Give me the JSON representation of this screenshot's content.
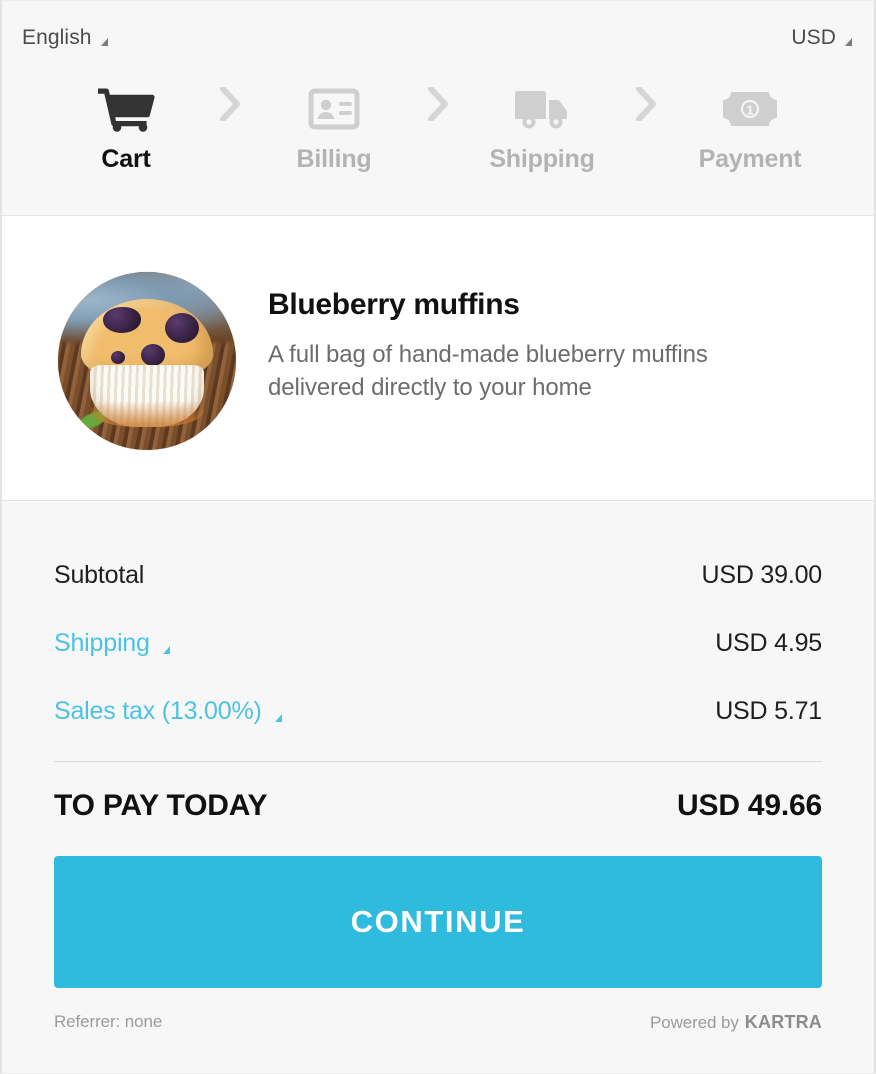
{
  "topbar": {
    "language": {
      "value": "English",
      "icon": "triangle-down-icon"
    },
    "currency": {
      "value": "USD",
      "icon": "triangle-down-icon"
    }
  },
  "stepper": {
    "separator_icon": "chevron-right-icon",
    "steps": [
      {
        "id": "cart",
        "label": "Cart",
        "icon": "shopping-cart-icon",
        "active": true
      },
      {
        "id": "billing",
        "label": "Billing",
        "icon": "id-card-icon",
        "active": false
      },
      {
        "id": "shipping",
        "label": "Shipping",
        "icon": "delivery-truck-icon",
        "active": false
      },
      {
        "id": "payment",
        "label": "Payment",
        "icon": "banknote-icon",
        "active": false
      }
    ]
  },
  "product": {
    "image_alt": "blueberry-muffin-photo",
    "title": "Blueberry muffins",
    "description": "A full bag of hand-made blueberry muffins delivered directly to your home"
  },
  "totals": {
    "rows": [
      {
        "label": "Subtotal",
        "value": "USD 39.00",
        "link": false,
        "expandable": false
      },
      {
        "label": "Shipping",
        "value": "USD 4.95",
        "link": true,
        "expandable": true
      },
      {
        "label": "Sales tax (13.00%)",
        "value": "USD 5.71",
        "link": true,
        "expandable": true
      }
    ],
    "grand_total": {
      "label": "TO PAY TODAY",
      "value": "USD 49.66"
    }
  },
  "actions": {
    "continue_label": "CONTINUE"
  },
  "footer": {
    "referrer": "Referrer: none",
    "powered_by": "Powered by",
    "brand": "KARTRA"
  },
  "colors": {
    "accent": "#4cc3e0",
    "button": "#2fbbdd",
    "header_bg": "#f7f7f7",
    "totals_bg": "#f7f7f7",
    "text_dark": "#1f1f1f",
    "text_muted": "#6d6d6d",
    "step_inactive": "#b3b3b3"
  }
}
